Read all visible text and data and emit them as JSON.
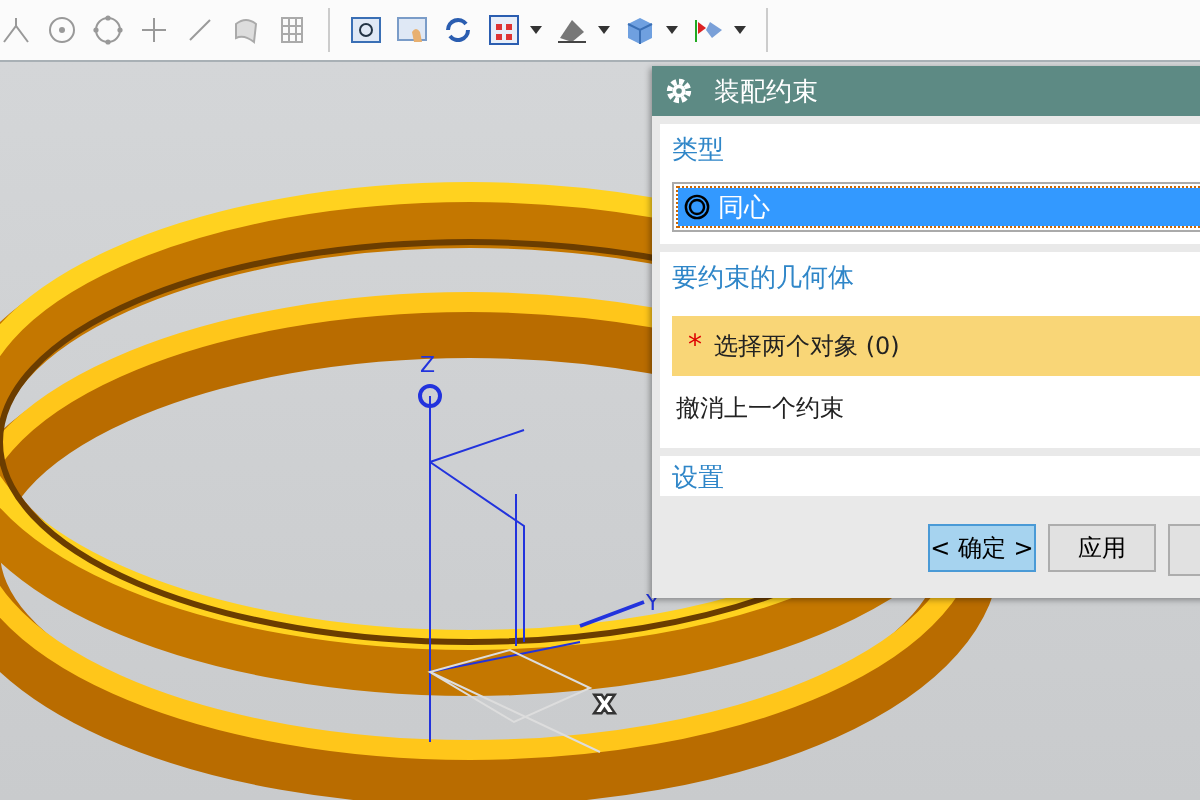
{
  "viewport": {
    "axes": [
      {
        "label": "Z"
      },
      {
        "label": "Y"
      },
      {
        "label": "X"
      }
    ]
  },
  "dialog": {
    "title": "装配约束",
    "type_section": {
      "title": "类型",
      "value": "同心",
      "selected": true
    },
    "geometry_section": {
      "title": "要约束的几何体",
      "required_mark": "*",
      "prompt": "选择两个对象 (0)",
      "undo_label": "撤消上一个约束"
    },
    "settings_section": {
      "title": "设置"
    },
    "buttons": [
      {
        "label": "< 确定 >",
        "selected": true
      },
      {
        "label": "应用",
        "selected": false
      }
    ]
  }
}
